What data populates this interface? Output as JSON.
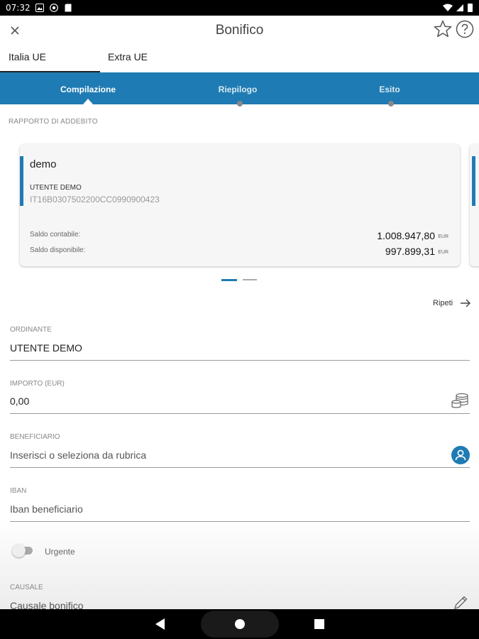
{
  "status_bar": {
    "time": "07:32"
  },
  "app_bar": {
    "title": "Bonifico"
  },
  "tabs": [
    {
      "label": "Italia UE"
    },
    {
      "label": "Extra UE"
    }
  ],
  "stepper": [
    {
      "label": "Compilazione"
    },
    {
      "label": "Riepilogo"
    },
    {
      "label": "Esito"
    }
  ],
  "section_label": "RAPPORTO DI ADDEBITO",
  "account_card": {
    "name": "demo",
    "holder": "UTENTE DEMO",
    "iban": "IT16B0307502200CC0990900423",
    "balance_label": "Saldo contabile:",
    "balance_value": "1.008.947,80",
    "available_label": "Saldo disponibile:",
    "available_value": "997.899,31",
    "currency": "EUR"
  },
  "repeat_link": "Ripeti",
  "form": {
    "ordinante": {
      "label": "ORDINANTE",
      "value": "UTENTE DEMO"
    },
    "importo": {
      "label": "IMPORTO (EUR)",
      "value": "0,00"
    },
    "beneficiario": {
      "label": "BENEFICIARIO",
      "placeholder": "Inserisci o seleziona da rubrica"
    },
    "iban": {
      "label": "IBAN",
      "placeholder": "Iban beneficiario"
    },
    "urgente": {
      "label": "Urgente",
      "checked": false
    },
    "causale": {
      "label": "CAUSALE",
      "placeholder": "Causale bonifico"
    }
  },
  "icons": {
    "close": "close-icon",
    "star": "star-icon",
    "help": "help-icon",
    "arrow": "arrow-right-icon",
    "coins": "coins-icon",
    "contact": "contact-book-icon",
    "pencil": "pencil-icon"
  },
  "colors": {
    "accent": "#1f7bb3"
  }
}
